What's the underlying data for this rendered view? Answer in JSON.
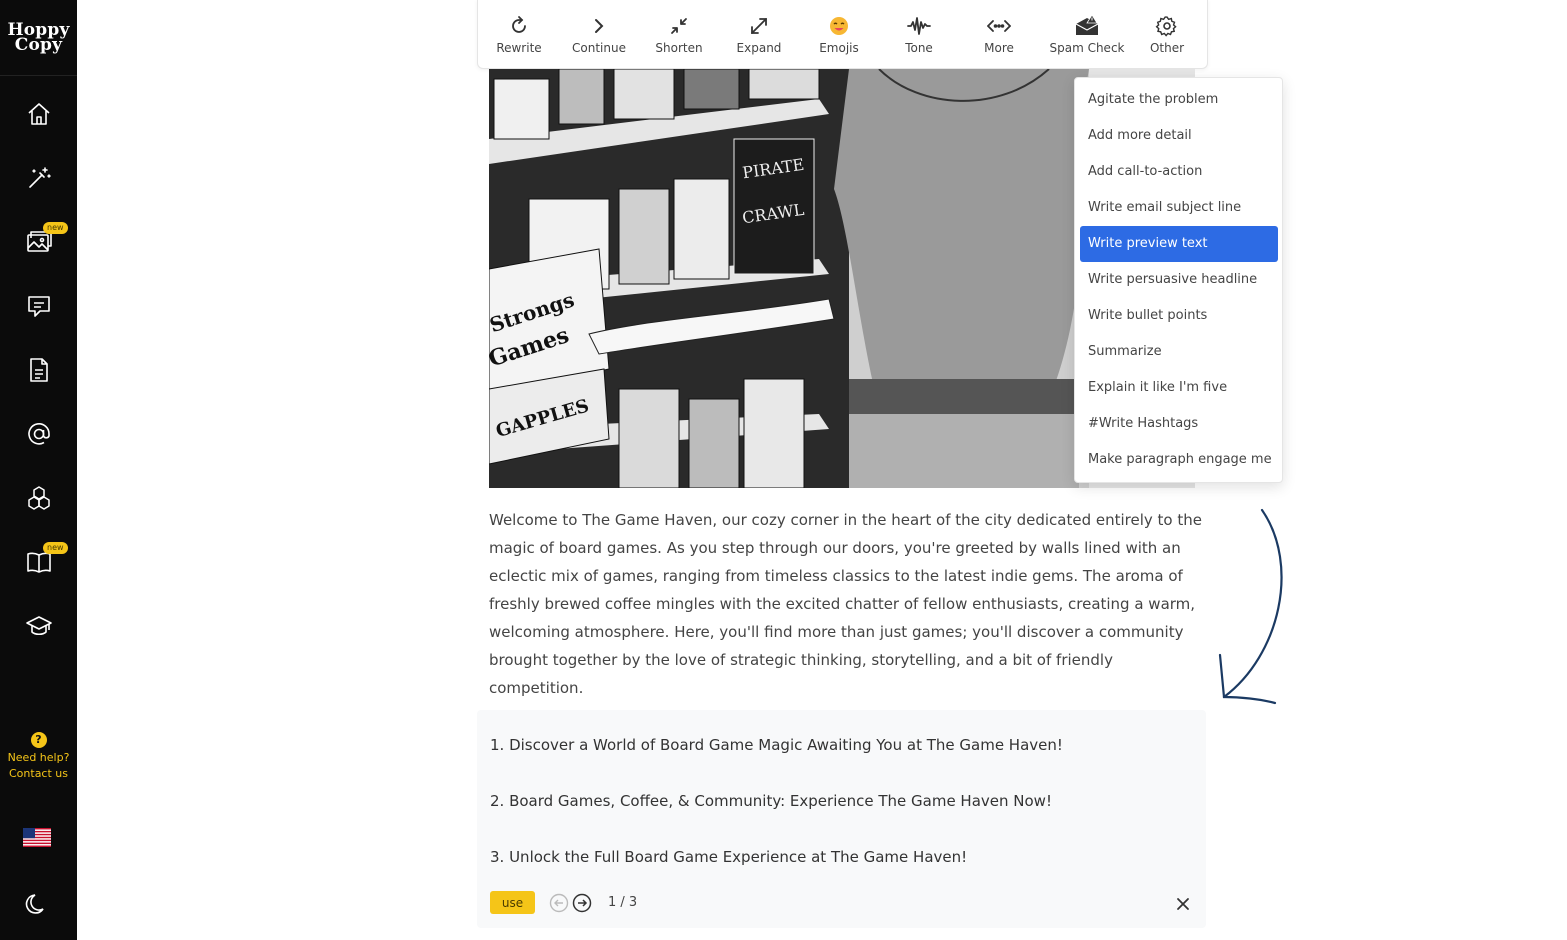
{
  "brand": {
    "logo_text_line1": "Hoppy",
    "logo_text_line2": "Copy"
  },
  "sidebar": {
    "items": [
      {
        "name": "home",
        "icon": "home-icon"
      },
      {
        "name": "magic",
        "icon": "magic-wand-icon"
      },
      {
        "name": "images",
        "icon": "image-icon",
        "badge": "new"
      },
      {
        "name": "chat",
        "icon": "chat-icon"
      },
      {
        "name": "documents",
        "icon": "document-icon"
      },
      {
        "name": "email",
        "icon": "at-icon"
      },
      {
        "name": "integrations",
        "icon": "cubes-icon"
      },
      {
        "name": "library",
        "icon": "book-icon",
        "badge": "new"
      },
      {
        "name": "academy",
        "icon": "graduation-cap-icon"
      }
    ],
    "help_line1": "Need help?",
    "help_line2": "Contact us",
    "help_icon_text": "?",
    "language_icon": "us-flag-icon",
    "theme_icon": "moon-icon"
  },
  "toolbar": {
    "tools": [
      {
        "label": "Rewrite",
        "icon": "rewrite-icon"
      },
      {
        "label": "Continue",
        "icon": "chevron-right-icon"
      },
      {
        "label": "Shorten",
        "icon": "shrink-icon"
      },
      {
        "label": "Expand",
        "icon": "expand-icon"
      },
      {
        "label": "Emojis",
        "icon": "emoji-icon"
      },
      {
        "label": "Tone",
        "icon": "waveform-icon"
      },
      {
        "label": "More",
        "icon": "code-dots-icon"
      },
      {
        "label": "Spam Check",
        "icon": "spam-mail-icon"
      },
      {
        "label": "Other",
        "icon": "gear-icon"
      }
    ]
  },
  "dropdown": {
    "items": [
      "Agitate the problem",
      "Add more detail",
      "Add call-to-action",
      "Write email subject line",
      "Write preview text",
      "Write persuasive headline",
      "Write bullet points",
      "Summarize",
      "Explain it like I'm five",
      "#Write Hashtags",
      "Make paragraph engage me"
    ],
    "active_index": 4
  },
  "content": {
    "paragraph": "Welcome to The Game Haven, our cozy corner in the heart of the city dedicated entirely to the magic of board games. As you step through our doors, you're greeted by walls lined with an eclectic mix of games, ranging from timeless classics to the latest indie gems. The aroma of freshly brewed coffee mingles with the excited chatter of fellow enthusiasts, creating a warm, welcoming atmosphere. Here, you'll find more than just games; you'll discover a community brought together by the love of strategic thinking, storytelling, and a bit of friendly competition."
  },
  "image_box_texts": {
    "box1": "Strongs",
    "box1b": "Games",
    "box2": "GAPPLES",
    "box3": "PIRATE",
    "box3b": "CRAWL"
  },
  "suggestions": {
    "items": [
      "1. Discover a World of Board Game Magic Awaiting You at The Game Haven!",
      "2. Board Games, Coffee, & Community: Experience The Game Haven Now!",
      "3. Unlock the Full Board Game Experience at The Game Haven!"
    ],
    "use_label": "use",
    "counter": "1 / 3",
    "close_glyph": "✕"
  },
  "colors": {
    "accent": "#2d6be4",
    "badge": "#f5c518",
    "sidebar": "#0b0b0b",
    "arrow": "#1b3a63"
  }
}
